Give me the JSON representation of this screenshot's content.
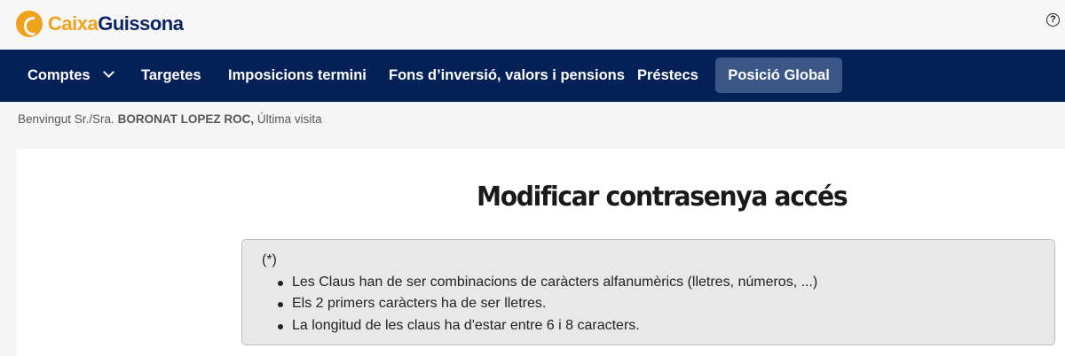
{
  "brand": {
    "name_part1": "Caixa",
    "name_part2": "Guissona",
    "colors": {
      "orange": "#f0a21d",
      "navy": "#052158",
      "active_tab": "#3c5687"
    }
  },
  "header": {
    "help_icon": "question-circle-icon",
    "help_glyph": "?"
  },
  "nav": {
    "items": [
      {
        "label": "Comptes",
        "has_dropdown": true
      },
      {
        "label": "Targetes"
      },
      {
        "label": "Imposicions termini"
      },
      {
        "label": "Fons d’inversió, valors i pensions"
      },
      {
        "label": "Préstecs"
      },
      {
        "label": "Posició Global",
        "active": true
      }
    ]
  },
  "welcome": {
    "prefix": "Benvingut Sr./Sra.",
    "name": "BORONAT LOPEZ ROC,",
    "last_visit": "Última visita"
  },
  "main": {
    "title": "Modificar contrasenya accés",
    "note_marker": "(*)",
    "rules": [
      "Les Claus han de ser combinacions de caràcters alfanumèrics (lletres, números, ...)",
      "Els 2 primers caràcters ha de ser lletres.",
      "La longitud de les claus ha d'estar entre 6 i 8 caracters."
    ]
  }
}
